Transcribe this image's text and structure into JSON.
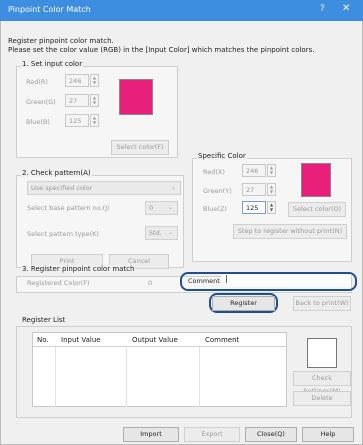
{
  "window": {
    "title": "Pinpoint Color Match",
    "help_glyph": "?",
    "close_glyph": "✕"
  },
  "intro": {
    "line1": "Register pinpoint color match.",
    "line2": "Please set the color value (RGB) in the [Input Color] which matches the pinpoint colors."
  },
  "input_color": {
    "title": "1. Set input color",
    "red_label": "Red(R)",
    "red_value": "246",
    "green_label": "Green(G)",
    "green_value": "27",
    "blue_label": "Blue(B)",
    "blue_value": "125",
    "select_button": "Select color(F)",
    "swatch_color": "#e8207c"
  },
  "check_pattern": {
    "title": "2. Check pattern(A)",
    "pattern_select": "Use specified color",
    "base_pattern_label": "Select base pattern no.(J)",
    "base_pattern_value": "0",
    "pattern_type_label": "Select pattern type(K)",
    "pattern_type_value": "Std.",
    "print_button": "Print",
    "cancel_button": "Cancel"
  },
  "specific_color": {
    "title": "Specific Color",
    "red_label": "Red(X)",
    "red_value": "246",
    "green_label": "Green(Y)",
    "green_value": "27",
    "blue_label": "Blue(Z)",
    "blue_value": "125",
    "select_button": "Select color(O)",
    "step_button": "Step to register without print(N)",
    "swatch_color": "#e8207c"
  },
  "register_match": {
    "title": "3. Register pinpoint color match",
    "registered_label": "Registered Color(F)",
    "registered_value": "0",
    "comment_label": "Comment",
    "comment_value": "",
    "register_button": "Register",
    "back_button": "Back to print(W)"
  },
  "register_list": {
    "title": "Register List",
    "columns": [
      "No.",
      "Input Value",
      "Output Value",
      "Comment"
    ],
    "check_settings_button": "Check Settings(M)",
    "delete_button": "Delete"
  },
  "footer": {
    "import_button": "Import",
    "export_button": "Export",
    "close_button": "Close(Q)",
    "help_button": "Help"
  },
  "colors": {
    "titlebar": "#3d8ee0",
    "highlight": "#1f4f8f",
    "swatch": "#e8207c"
  }
}
